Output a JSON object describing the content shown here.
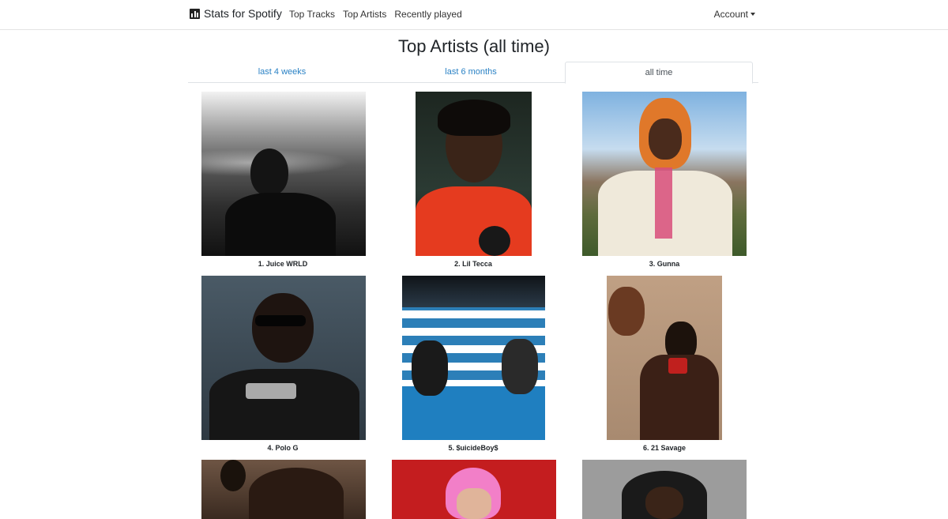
{
  "navbar": {
    "brand": "Stats for Spotify",
    "brand_icon": "bar-chart-icon",
    "links": [
      "Top Tracks",
      "Top Artists",
      "Recently played"
    ],
    "account": "Account"
  },
  "page": {
    "title": "Top Artists (all time)"
  },
  "tabs": [
    {
      "label": "last 4 weeks",
      "active": false
    },
    {
      "label": "last 6 months",
      "active": false
    },
    {
      "label": "all time",
      "active": true
    }
  ],
  "colors": {
    "link": "#2a82c5",
    "text": "#212529",
    "border": "#dee2e6"
  },
  "artists": [
    {
      "label": "1. Juice WRLD"
    },
    {
      "label": "2. Lil Tecca"
    },
    {
      "label": "3. Gunna"
    },
    {
      "label": "4. Polo G"
    },
    {
      "label": "5. $uicideBoy$"
    },
    {
      "label": "6. 21 Savage"
    },
    {
      "label": ""
    },
    {
      "label": ""
    },
    {
      "label": ""
    }
  ]
}
